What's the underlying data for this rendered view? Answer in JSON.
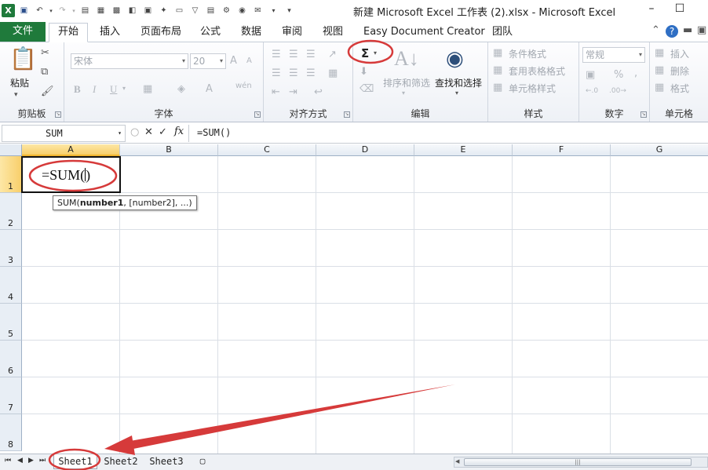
{
  "window": {
    "title": "新建 Microsoft Excel 工作表 (2).xlsx  -  Microsoft Excel",
    "minimize": "–",
    "maximize": "☐"
  },
  "qat": {
    "app_icon": "X",
    "icons": [
      "excel-icon",
      "save-icon",
      "undo-icon",
      "redo-icon",
      "print-icon"
    ]
  },
  "ribbon_tabs": [
    "文件",
    "开始",
    "插入",
    "页面布局",
    "公式",
    "数据",
    "审阅",
    "视图",
    "Easy Document Creator",
    "团队"
  ],
  "groups": {
    "clipboard": {
      "label": "剪贴板",
      "paste": "粘贴"
    },
    "font": {
      "label": "字体",
      "font_name": "宋体",
      "font_size": "20",
      "bold": "B",
      "italic": "I",
      "underline": "U",
      "grow": "A",
      "shrink": "A",
      "color": "A",
      "wen": "wén"
    },
    "alignment": {
      "label": "对齐方式"
    },
    "editing": {
      "label": "编辑",
      "sum": "Σ",
      "sort_filter": "排序和筛选",
      "find_select": "查找和选择"
    },
    "styles": {
      "label": "样式",
      "conditional": "条件格式",
      "table_format": "套用表格格式",
      "cell_styles": "单元格样式"
    },
    "number": {
      "label": "数字",
      "format": "常规",
      "percent": "%",
      "comma": ",",
      "inc": "←.0\n.00",
      "dec": ".00\n→.0"
    },
    "cells": {
      "label": "单元格",
      "insert": "插入",
      "delete": "删除",
      "format": "格式"
    }
  },
  "formula_bar": {
    "name_box": "SUM",
    "cancel": "✕",
    "enter": "✓",
    "fx": "fx",
    "content": "=SUM()"
  },
  "grid": {
    "columns": [
      "A",
      "B",
      "C",
      "D",
      "E",
      "F",
      "G"
    ],
    "rows": [
      "1",
      "2",
      "3",
      "4",
      "5",
      "6",
      "7",
      "8"
    ],
    "active_cell": "A1",
    "cell_a1_value": "=SUM(",
    "cell_a1_close": ")"
  },
  "tooltip": {
    "prefix": "SUM(",
    "bold": "number1",
    "rest": ", [number2], ...)"
  },
  "sheets": [
    "Sheet1",
    "Sheet2",
    "Sheet3"
  ],
  "annotation_color": "#d63a3a"
}
